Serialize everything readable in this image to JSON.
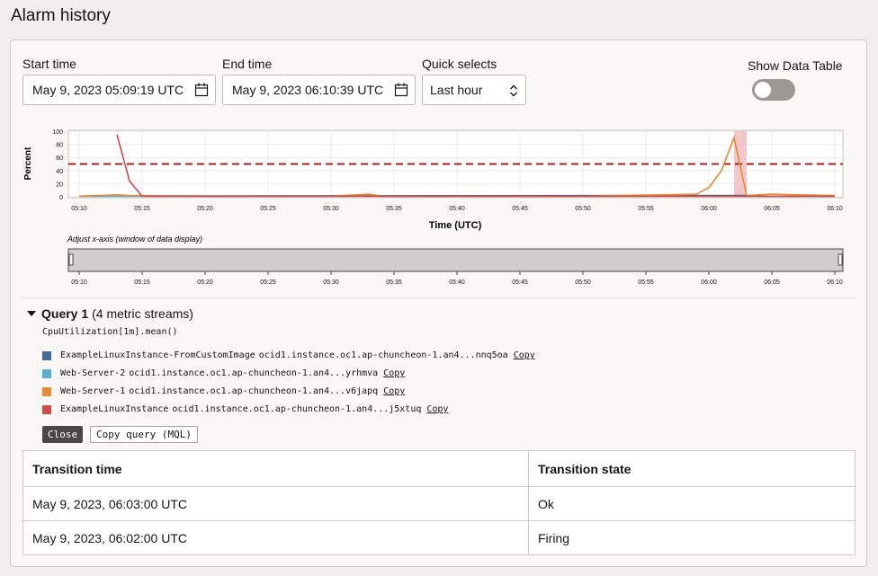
{
  "page": {
    "title": "Alarm history"
  },
  "filters": {
    "start_label": "Start time",
    "start_value": "May 9, 2023 05:09:19 UTC",
    "end_label": "End time",
    "end_value": "May 9, 2023 06:10:39 UTC",
    "quick_label": "Quick selects",
    "quick_value": "Last hour",
    "show_table_label": "Show Data Table",
    "show_table_on": false
  },
  "chart_data": {
    "type": "line",
    "ylabel": "Percent",
    "xlabel": "Time (UTC)",
    "ylim": [
      0,
      100
    ],
    "y_ticks": [
      "0",
      "20",
      "40",
      "60",
      "80",
      "100"
    ],
    "x": [
      "05:10",
      "05:15",
      "05:20",
      "05:25",
      "05:30",
      "05:35",
      "05:40",
      "05:45",
      "05:50",
      "05:55",
      "06:00",
      "06:05",
      "06:10"
    ],
    "threshold": 50,
    "threshold_color": "#a82222",
    "alarm_window": [
      "06:02",
      "06:03"
    ],
    "series": [
      {
        "name": "ExampleLinuxInstance",
        "color": "#d24a4a",
        "points": [
          [
            "05:13",
            95
          ],
          [
            "05:14",
            24
          ],
          [
            "05:15",
            1
          ],
          [
            "05:20",
            1
          ],
          [
            "05:30",
            1
          ],
          [
            "05:40",
            1
          ],
          [
            "05:50",
            1
          ],
          [
            "06:00",
            1
          ],
          [
            "06:10",
            1
          ]
        ]
      },
      {
        "name": "Web-Server-1",
        "color": "#ec8a33",
        "points": [
          [
            "05:10",
            1
          ],
          [
            "05:13",
            3
          ],
          [
            "05:14",
            2
          ],
          [
            "05:20",
            1
          ],
          [
            "05:30",
            1
          ],
          [
            "05:33",
            4
          ],
          [
            "05:34",
            1
          ],
          [
            "05:40",
            1
          ],
          [
            "05:50",
            1
          ],
          [
            "05:59",
            4
          ],
          [
            "06:00",
            14
          ],
          [
            "06:01",
            40
          ],
          [
            "06:02",
            90
          ],
          [
            "06:03",
            2
          ],
          [
            "06:04",
            3
          ],
          [
            "06:05",
            4
          ],
          [
            "06:07",
            3
          ],
          [
            "06:10",
            2
          ]
        ]
      },
      {
        "name": "Web-Server-2",
        "color": "#5aaed4",
        "points": [
          [
            "05:10",
            1
          ],
          [
            "06:10",
            1
          ]
        ]
      },
      {
        "name": "ExampleLinuxInstance-FromCustomImage",
        "color": "#3f6b97",
        "points": [
          [
            "05:10",
            1
          ],
          [
            "06:03",
            2
          ],
          [
            "06:04",
            1
          ],
          [
            "06:10",
            1
          ]
        ]
      }
    ]
  },
  "slider": {
    "label": "Adjust x-axis (window of data display)"
  },
  "query": {
    "title": "Query 1",
    "count": "(4 metric streams)",
    "expression": "CpuUtilization[1m].mean()",
    "copy_label": "Copy",
    "streams": [
      {
        "name": "ExampleLinuxInstance-FromCustomImage",
        "id": "ocid1.instance.oc1.ap-chuncheon-1.an4...nnq5oa",
        "color": "#3f6b97"
      },
      {
        "name": "Web-Server-2",
        "id": "ocid1.instance.oc1.ap-chuncheon-1.an4...yrhmva",
        "color": "#5aaed4"
      },
      {
        "name": "Web-Server-1",
        "id": "ocid1.instance.oc1.ap-chuncheon-1.an4...v6japq",
        "color": "#ec8a33"
      },
      {
        "name": "ExampleLinuxInstance",
        "id": "ocid1.instance.oc1.ap-chuncheon-1.an4...j5xtuq",
        "color": "#d24a4a"
      }
    ],
    "close_label": "Close",
    "copy_query_label": "Copy query (MQL)"
  },
  "transitions": {
    "headers": [
      "Transition time",
      "Transition state"
    ],
    "rows": [
      [
        "May 9, 2023, 06:03:00 UTC",
        "Ok"
      ],
      [
        "May 9, 2023, 06:02:00 UTC",
        "Firing"
      ]
    ]
  }
}
